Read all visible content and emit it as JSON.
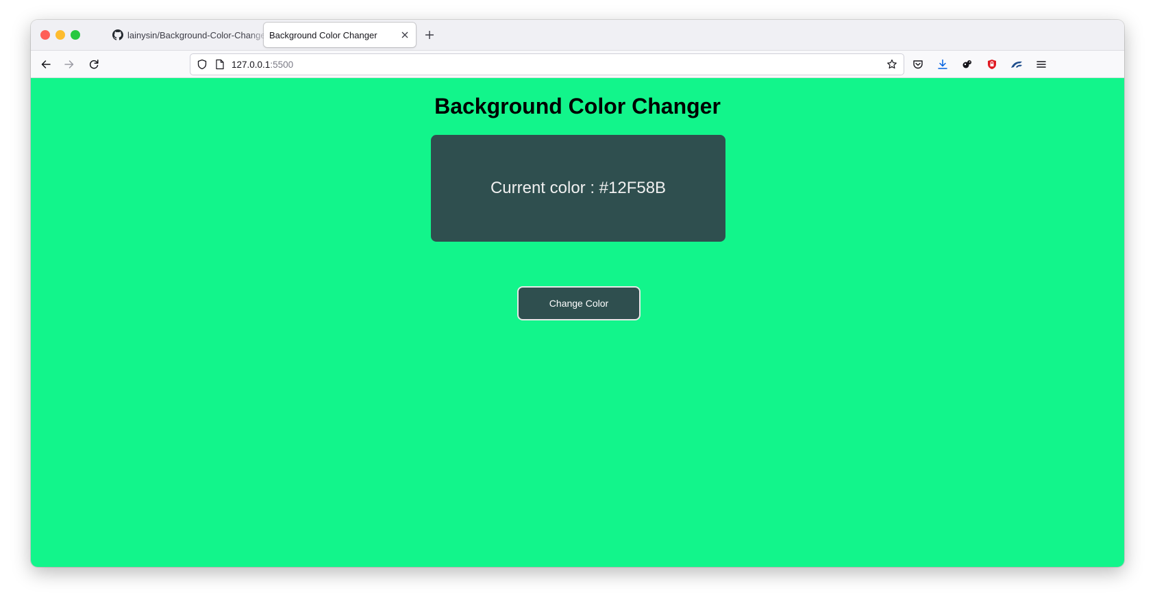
{
  "browser": {
    "tabs": [
      {
        "title": "lainysin/Background-Color-Changer",
        "favicon": "github-icon",
        "active": false
      },
      {
        "title": "Background Color Changer",
        "favicon": null,
        "active": true
      }
    ],
    "url": {
      "host": "127.0.0.1",
      "port": ":5500"
    },
    "icons": {
      "back": "arrow-left-icon",
      "forward": "arrow-right-icon",
      "reload": "reload-icon",
      "tracking_protection": "shield-icon",
      "page_info": "page-icon",
      "bookmark": "star-icon",
      "pocket": "pocket-icon",
      "downloads": "download-icon",
      "extension_1": "extension-icon",
      "extension_2": "ublock-icon",
      "extension_3": "extension-icon",
      "menu": "hamburger-menu-icon"
    }
  },
  "page": {
    "title": "Background Color Changer",
    "current_color_text": "Current color : #12F58B",
    "button_label": "Change Color",
    "colors": {
      "background": "#12F58B",
      "box": "#2F4F4F",
      "button": "#2F4F4F"
    }
  }
}
